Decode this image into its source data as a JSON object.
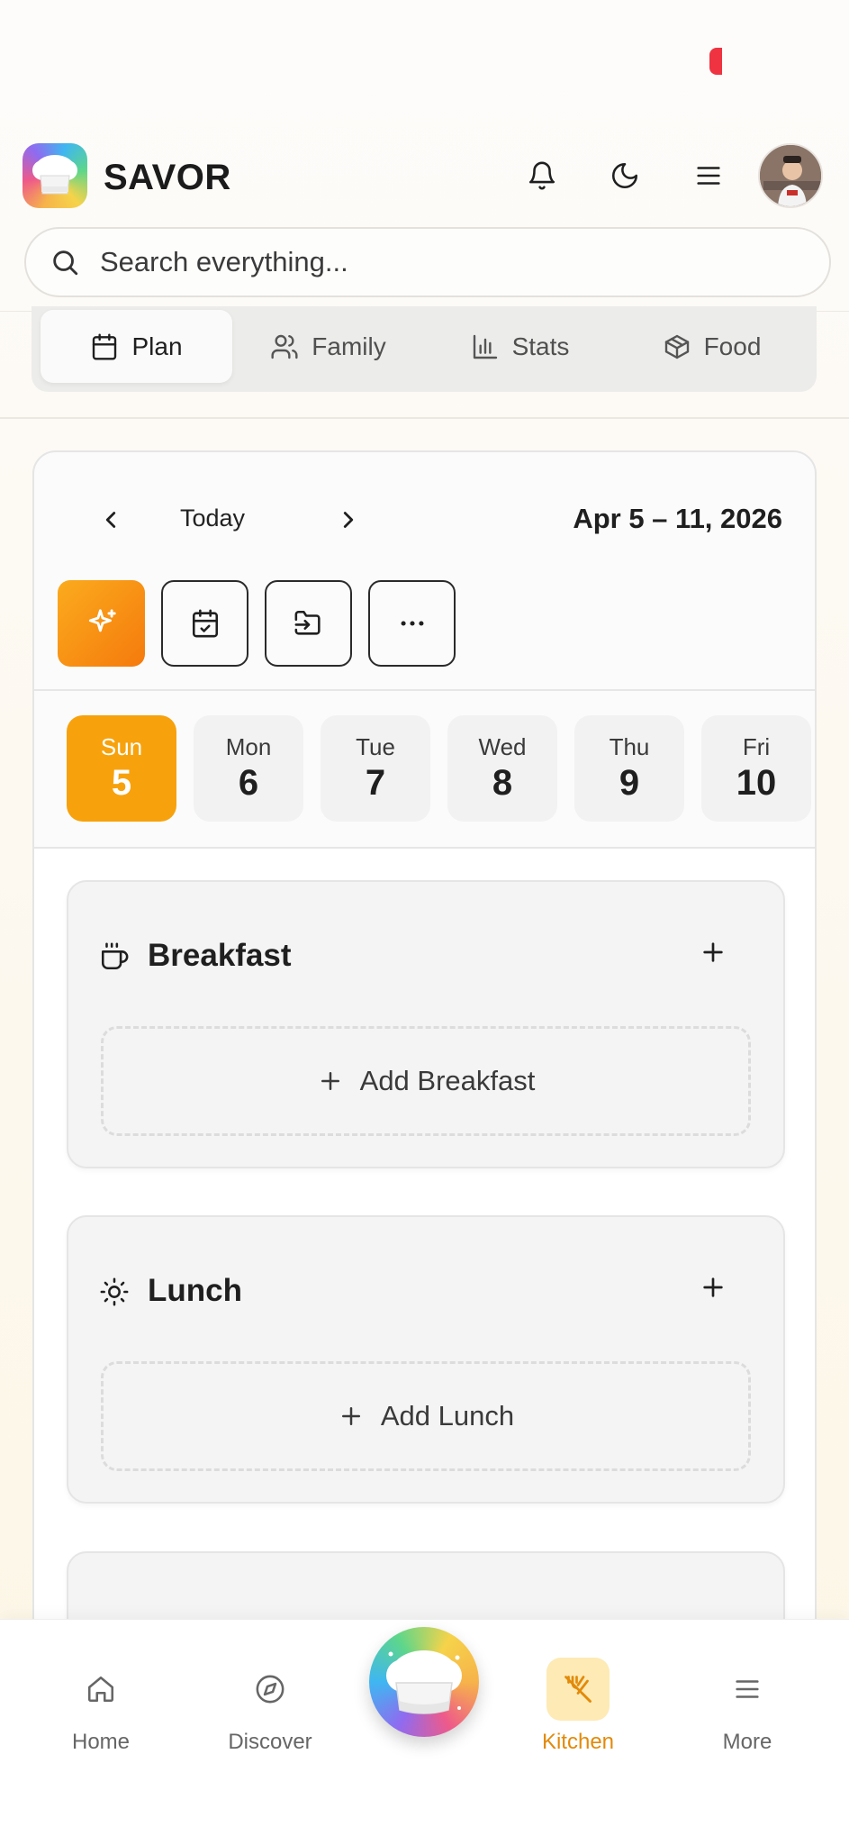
{
  "app": {
    "name": "SAVOR"
  },
  "search": {
    "placeholder": "Search everything..."
  },
  "tabs": [
    {
      "label": "Plan",
      "icon": "calendar-icon",
      "active": true
    },
    {
      "label": "Family",
      "icon": "users-icon",
      "active": false
    },
    {
      "label": "Stats",
      "icon": "bar-chart-icon",
      "active": false
    },
    {
      "label": "Food",
      "icon": "package-icon",
      "active": false
    }
  ],
  "week": {
    "today_label": "Today",
    "range": "Apr 5 – 11, 2026"
  },
  "days": [
    {
      "name": "Sun",
      "date": "5",
      "active": true
    },
    {
      "name": "Mon",
      "date": "6",
      "active": false
    },
    {
      "name": "Tue",
      "date": "7",
      "active": false
    },
    {
      "name": "Wed",
      "date": "8",
      "active": false
    },
    {
      "name": "Thu",
      "date": "9",
      "active": false
    },
    {
      "name": "Fri",
      "date": "10",
      "active": false
    }
  ],
  "meals": [
    {
      "title": "Breakfast",
      "add_label": "Add Breakfast",
      "icon": "coffee-icon"
    },
    {
      "title": "Lunch",
      "add_label": "Add Lunch",
      "icon": "sun-icon"
    }
  ],
  "nav": [
    {
      "label": "Home",
      "icon": "home-icon",
      "active": false
    },
    {
      "label": "Discover",
      "icon": "compass-icon",
      "active": false
    },
    {
      "label": "Kitchen",
      "icon": "utensils-icon",
      "active": true
    },
    {
      "label": "More",
      "icon": "menu-icon",
      "active": false
    }
  ],
  "colors": {
    "accent": "#f7a20c",
    "accent_dark": "#f57a0c",
    "active_nav": "#e28a0a",
    "active_nav_bg": "#fdeab5",
    "notification": "#ef3340"
  }
}
